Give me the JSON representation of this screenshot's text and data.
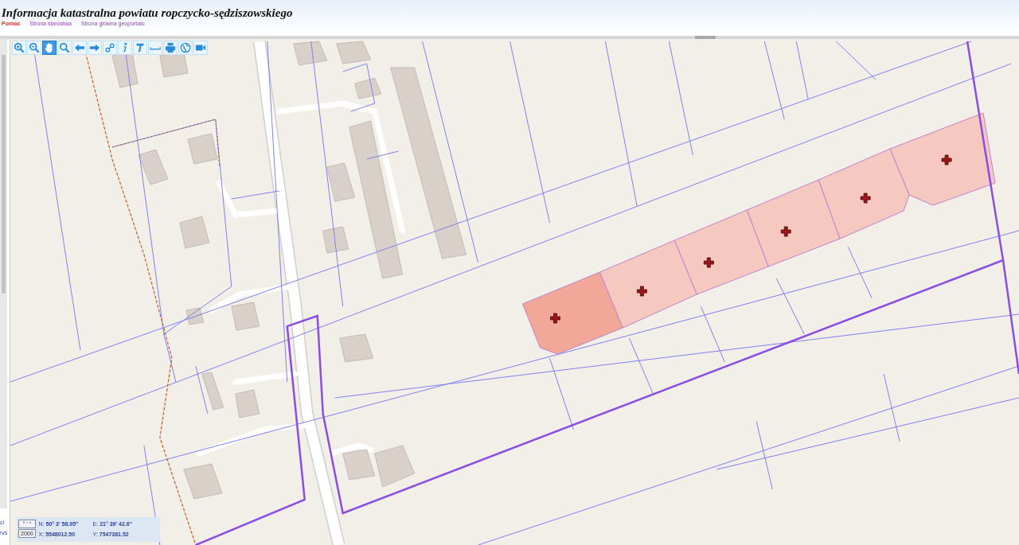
{
  "header": {
    "title": "Informacja katastralna powiatu ropczycko-sędziszowskiego",
    "links": [
      {
        "label": "Pomoc",
        "kind": "help"
      },
      {
        "label": "Strona starostwa",
        "kind": "external"
      },
      {
        "label": "Strona główna geoportalu",
        "kind": "external"
      }
    ]
  },
  "toolbar": [
    {
      "kind": "zoom-in",
      "selected": false
    },
    {
      "kind": "zoom-out",
      "selected": false
    },
    {
      "kind": "pan",
      "selected": true
    },
    {
      "kind": "zoom",
      "selected": false
    },
    {
      "kind": "back",
      "selected": false
    },
    {
      "kind": "forward",
      "selected": false
    },
    {
      "kind": "link",
      "selected": false
    },
    {
      "kind": "info",
      "selected": false
    },
    {
      "kind": "identify",
      "selected": false
    },
    {
      "kind": "measure",
      "selected": false
    },
    {
      "kind": "print",
      "selected": false
    },
    {
      "kind": "globe",
      "selected": false
    },
    {
      "kind": "camera",
      "selected": false
    }
  ],
  "left_panel": {
    "fragments": [
      "ci",
      "rys"
    ]
  },
  "coordinates": {
    "format_buttons": [
      "° ' \"",
      "2000"
    ],
    "rows": [
      [
        {
          "label": "N:",
          "value": "50° 3' 58.95\""
        },
        {
          "label": "E:",
          "value": "21° 39' 42.6\""
        }
      ],
      [
        {
          "label": "X:",
          "value": "5548012.50"
        },
        {
          "label": "Y:",
          "value": "7547381.52"
        }
      ]
    ]
  }
}
